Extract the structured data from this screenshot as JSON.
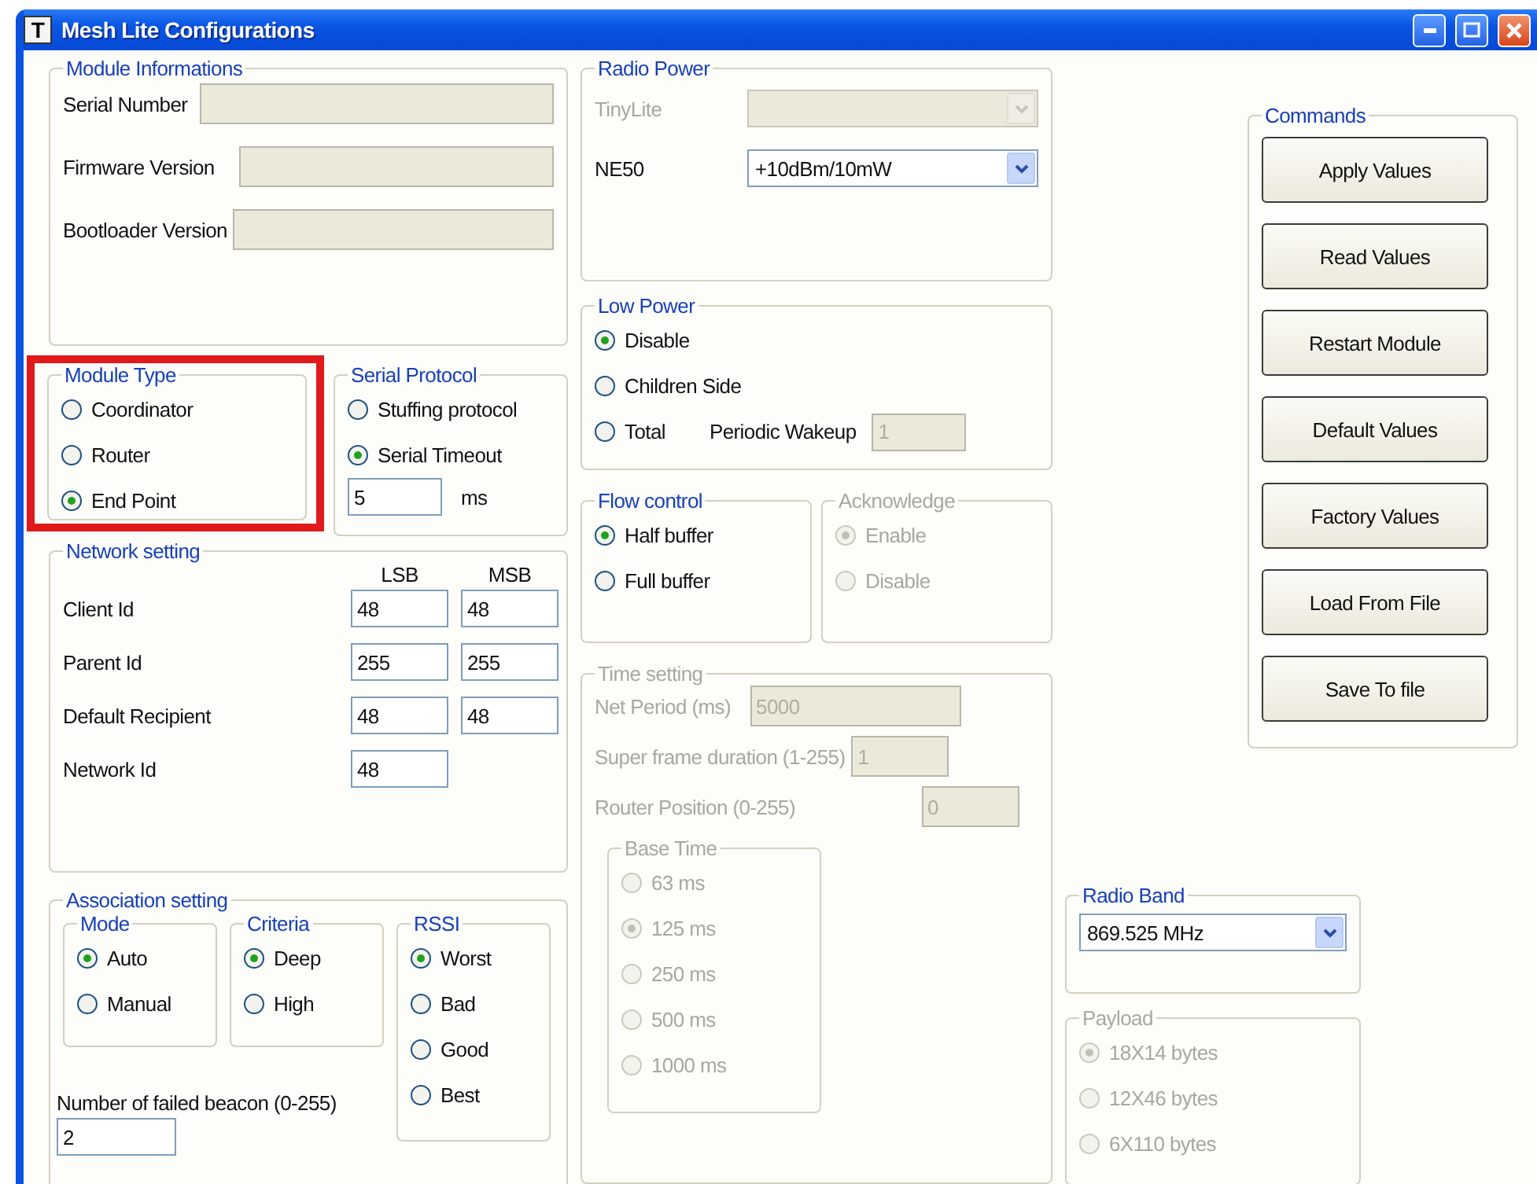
{
  "window": {
    "title": "Mesh Lite Configurations",
    "icon_text": "T"
  },
  "module_info": {
    "title": "Module Informations",
    "fields": [
      {
        "label": "Serial Number",
        "disabled": true
      },
      {
        "label": "Firmware Version",
        "disabled": true
      },
      {
        "label": "Bootloader Version",
        "disabled": true
      }
    ]
  },
  "module_type": {
    "title": "Module Type",
    "highlighted": true,
    "options": [
      {
        "label": "Coordinator",
        "selected": false
      },
      {
        "label": "Router",
        "selected": false
      },
      {
        "label": "End Point",
        "selected": true
      }
    ]
  },
  "serial_protocol": {
    "title": "Serial Protocol",
    "options": [
      {
        "label": "Stuffing protocol",
        "selected": false
      },
      {
        "label": "Serial Timeout",
        "selected": true
      }
    ],
    "timeout": {
      "value": "5",
      "unit": "ms"
    }
  },
  "network_setting": {
    "title": "Network setting",
    "columns": [
      "LSB",
      "MSB"
    ],
    "rows": [
      {
        "label": "Client Id",
        "values": [
          "48",
          "48"
        ]
      },
      {
        "label": "Parent Id",
        "values": [
          "255",
          "255"
        ]
      },
      {
        "label": "Default Recipient",
        "values": [
          "48",
          "48"
        ]
      },
      {
        "label": "Network Id",
        "values": [
          "48"
        ]
      }
    ]
  },
  "association": {
    "title": "Association setting",
    "groups": [
      {
        "title": "Mode",
        "options": [
          {
            "label": "Auto",
            "selected": true
          },
          {
            "label": "Manual",
            "selected": false
          }
        ]
      },
      {
        "title": "Criteria",
        "options": [
          {
            "label": "Deep",
            "selected": true
          },
          {
            "label": "High",
            "selected": false
          }
        ]
      },
      {
        "title": "RSSI",
        "options": [
          {
            "label": "Worst",
            "selected": true
          },
          {
            "label": "Bad",
            "selected": false
          },
          {
            "label": "Good",
            "selected": false
          },
          {
            "label": "Best",
            "selected": false
          }
        ]
      }
    ],
    "failed_beacon": {
      "label": "Number of failed beacon (0-255)",
      "value": "2"
    }
  },
  "radio_power": {
    "title": "Radio Power",
    "rows": [
      {
        "label": "TinyLite",
        "disabled": true
      },
      {
        "label": "NE50",
        "value": "+10dBm/10mW",
        "disabled": false
      }
    ]
  },
  "low_power": {
    "title": "Low Power",
    "options": [
      {
        "label": "Disable",
        "selected": true
      },
      {
        "label": "Children Side",
        "selected": false
      },
      {
        "label": "Total",
        "selected": false
      }
    ],
    "periodic_wakeup": {
      "label": "Periodic Wakeup",
      "value": "1",
      "disabled": true
    }
  },
  "flow_control": {
    "title": "Flow control",
    "disabled": false,
    "options": [
      {
        "label": "Half buffer",
        "selected": true
      },
      {
        "label": "Full buffer",
        "selected": false
      }
    ]
  },
  "acknowledge": {
    "title": "Acknowledge",
    "disabled": true,
    "options": [
      {
        "label": "Enable",
        "selected": true
      },
      {
        "label": "Disable",
        "selected": false
      }
    ]
  },
  "time_setting": {
    "title": "Time setting",
    "disabled": true,
    "fields": [
      {
        "label": "Net Period (ms)",
        "value": "5000"
      },
      {
        "label": "Super frame duration (1-255)",
        "value": "1"
      },
      {
        "label": "Router Position (0-255)",
        "value": "0"
      }
    ],
    "base_time": {
      "title": "Base Time",
      "options": [
        {
          "label": "63 ms",
          "selected": false
        },
        {
          "label": "125 ms",
          "selected": true
        },
        {
          "label": "250 ms",
          "selected": false
        },
        {
          "label": "500 ms",
          "selected": false
        },
        {
          "label": "1000 ms",
          "selected": false
        }
      ]
    }
  },
  "commands": {
    "title": "Commands",
    "buttons": [
      "Apply Values",
      "Read Values",
      "Restart Module",
      "Default Values",
      "Factory Values",
      "Load From File",
      "Save To file"
    ]
  },
  "radio_band": {
    "title": "Radio Band",
    "value": "869.525 MHz"
  },
  "payload": {
    "title": "Payload",
    "disabled": true,
    "options": [
      {
        "label": "18X14 bytes",
        "selected": true
      },
      {
        "label": "12X46 bytes",
        "selected": false
      },
      {
        "label": "6X110 bytes",
        "selected": false
      }
    ]
  }
}
